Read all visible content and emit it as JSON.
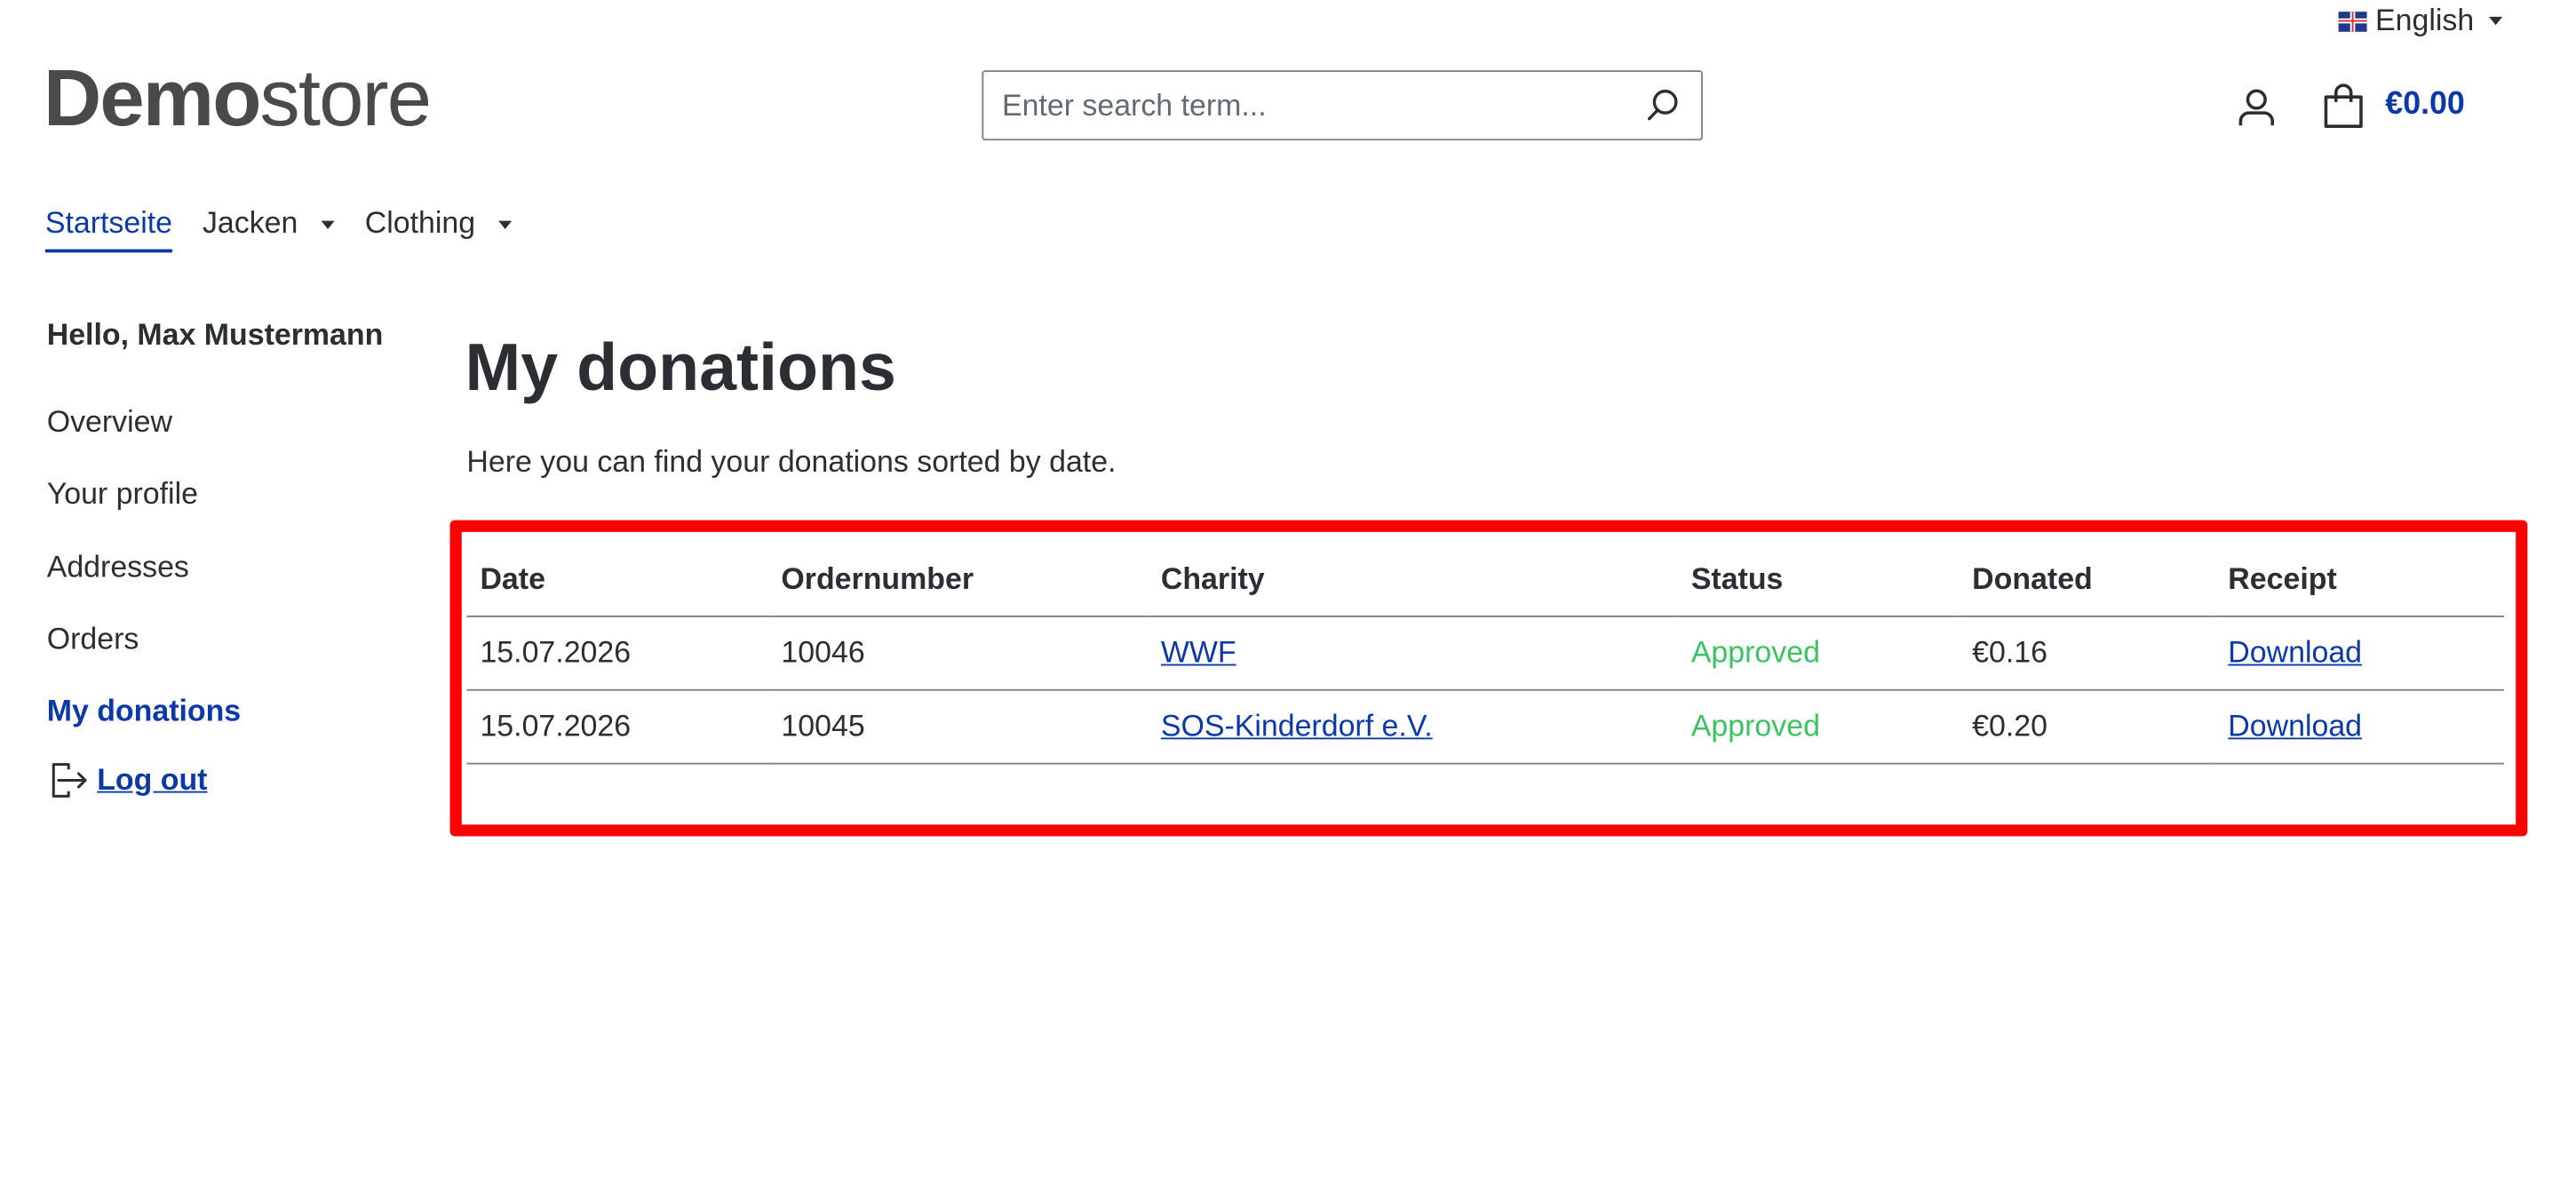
{
  "language": {
    "selected": "English",
    "flag_icon": "uk-flag-icon"
  },
  "header": {
    "logo_bold": "Demo",
    "logo_light": "store",
    "search": {
      "placeholder": "Enter search term...",
      "value": ""
    },
    "cart_total": "€0.00"
  },
  "nav": {
    "items": [
      {
        "label": "Startseite",
        "active": true
      },
      {
        "label": "Jacken",
        "dropdown": true
      },
      {
        "label": "Clothing",
        "dropdown": true
      }
    ]
  },
  "sidebar": {
    "greeting": "Hello, Max Mustermann",
    "items": [
      {
        "label": "Overview"
      },
      {
        "label": "Your profile"
      },
      {
        "label": "Addresses"
      },
      {
        "label": "Orders"
      },
      {
        "label": "My donations",
        "active": true
      }
    ],
    "logout": "Log out"
  },
  "main": {
    "title": "My donations",
    "description": "Here you can find your donations sorted by date.",
    "table": {
      "headers": [
        "Date",
        "Ordernumber",
        "Charity",
        "Status",
        "Donated",
        "Receipt"
      ],
      "rows": [
        {
          "date": "15.07.2026",
          "ordernumber": "10046",
          "charity": "WWF",
          "status": "Approved",
          "donated": "€0.16",
          "receipt": "Download"
        },
        {
          "date": "15.07.2026",
          "ordernumber": "10045",
          "charity": "SOS-Kinderdorf e.V.",
          "status": "Approved",
          "donated": "€0.20",
          "receipt": "Download"
        }
      ]
    }
  },
  "colors": {
    "primary": "#0b3aa8",
    "text": "#2b2f33",
    "approved": "#3cc261",
    "highlight": "#ff0000"
  }
}
